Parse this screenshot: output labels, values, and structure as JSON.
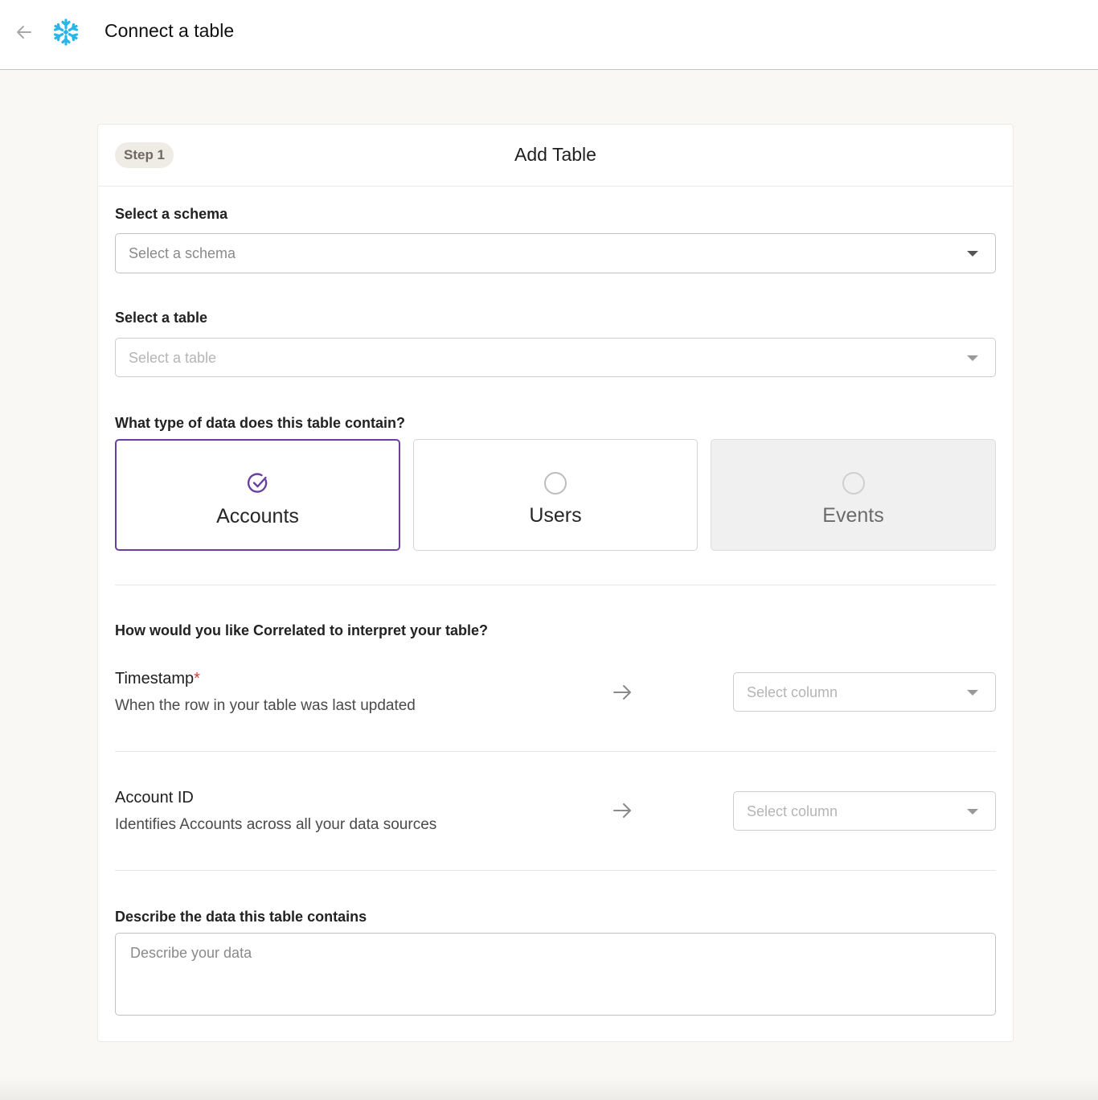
{
  "header": {
    "title": "Connect a table"
  },
  "card": {
    "step_label": "Step 1",
    "title": "Add Table"
  },
  "schema": {
    "label": "Select a schema",
    "placeholder": "Select a schema"
  },
  "table": {
    "label": "Select a table",
    "placeholder": "Select a table"
  },
  "data_type": {
    "question": "What type of data does this table contain?",
    "options": [
      {
        "label": "Accounts",
        "state": "selected"
      },
      {
        "label": "Users",
        "state": "unselected"
      },
      {
        "label": "Events",
        "state": "disabled"
      }
    ]
  },
  "interpret": {
    "question": "How would you like Correlated to interpret your table?",
    "fields": [
      {
        "title": "Timestamp",
        "required_mark": "*",
        "description": "When the row in your table was last updated",
        "placeholder": "Select column"
      },
      {
        "title": "Account ID",
        "description": "Identifies Accounts across all your data sources",
        "placeholder": "Select column"
      }
    ]
  },
  "describe": {
    "label": "Describe the data this table contains",
    "placeholder": "Describe your data"
  },
  "colors": {
    "accent": "#6b3fa0",
    "required": "#d33a3a",
    "logo": "#29b5e8"
  },
  "icons": {
    "back": "arrow-left-icon",
    "logo": "snowflake-icon",
    "dropdown": "caret-down-icon",
    "selected_option": "check-circle-icon",
    "unselected_option": "radio-icon",
    "mapping": "arrow-right-icon"
  }
}
